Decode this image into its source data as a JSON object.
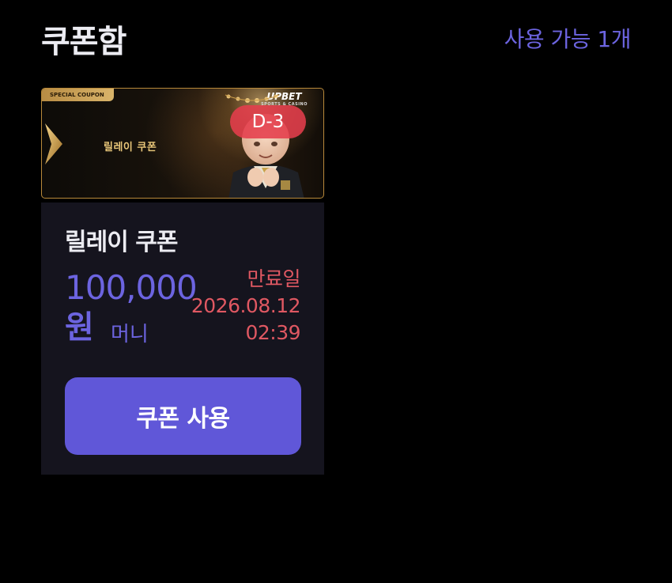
{
  "header": {
    "title": "쿠폰함",
    "available_count": "사용 가능 1개"
  },
  "coupon": {
    "banner": {
      "tag": "SPECIAL COUPON",
      "brand": "UPBET",
      "brand_sub": "SPORTS & CASINO",
      "banner_text": "릴레이 쿠폰",
      "dday": "D-3"
    },
    "name": "릴레이 쿠폰",
    "amount": "100,000",
    "currency": "원",
    "money_type": "머니",
    "expiry_label": "만료일",
    "expiry_date": "2026.08.12",
    "expiry_time": "02:39",
    "use_button": "쿠폰 사용"
  },
  "colors": {
    "background": "#000000",
    "card_body": "#15141e",
    "accent": "#6c64e0",
    "button": "#6057d8",
    "expiry": "#e05862",
    "dday_badge": "#e53e4c",
    "gold": "#b8893a"
  },
  "icons": {
    "chevron": "gold-chevron-icon",
    "mascot": "mascot-character-image",
    "chandelier": "chandelier-image"
  }
}
